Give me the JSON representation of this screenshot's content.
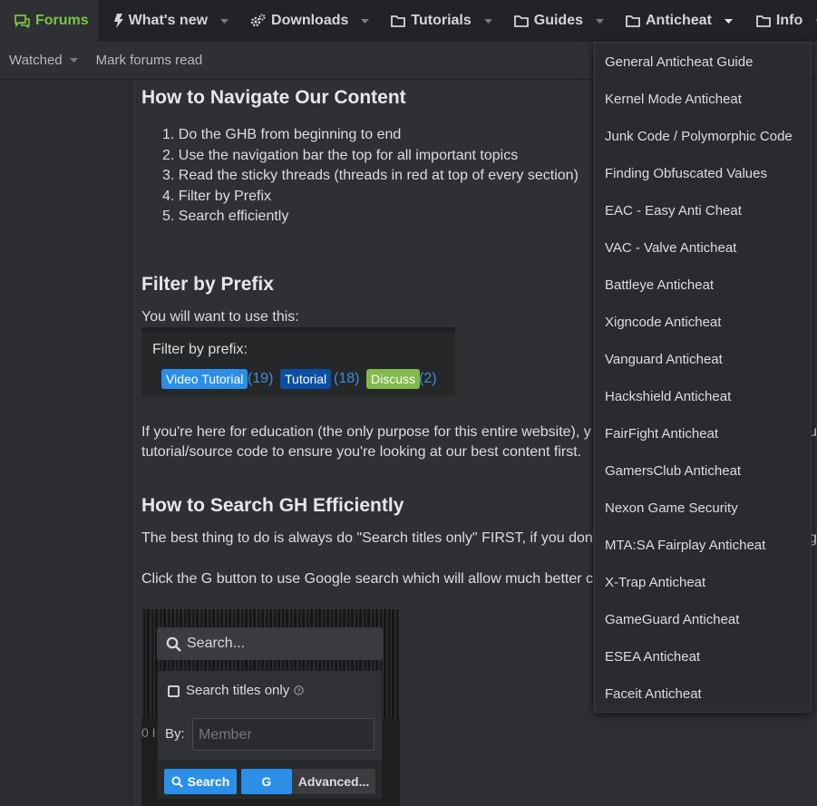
{
  "nav": {
    "tabs": [
      {
        "label": "Forums",
        "icon": "chat-bubbles-icon",
        "active": true
      },
      {
        "label": "What's new",
        "icon": "lightning-icon"
      },
      {
        "label": "Downloads",
        "icon": "gears-icon"
      },
      {
        "label": "Tutorials",
        "icon": "folder-icon"
      },
      {
        "label": "Guides",
        "icon": "folder-icon"
      },
      {
        "label": "Anticheat",
        "icon": "folder-icon"
      },
      {
        "label": "Info",
        "icon": "folder-icon"
      }
    ]
  },
  "subnav": {
    "watched": "Watched",
    "mark_read": "Mark forums read"
  },
  "content": {
    "h_navigate": "How to Navigate Our Content",
    "steps": [
      "1. Do the GHB from beginning to end",
      "2. Use the navigation bar the top for all important topics",
      "3. Read the sticky threads (threads in red at top of every section)",
      "4. Filter by Prefix",
      "5. Search efficiently"
    ],
    "h_filter": "Filter by Prefix",
    "use_this": "You will want to use this:",
    "prefix_box": {
      "label": "Filter by prefix:",
      "chips": [
        {
          "label": "Video Tutorial",
          "count": "(19)",
          "color": "#2b8fe8"
        },
        {
          "label": "Tutorial",
          "count": "(18)",
          "color": "#0c4ea2"
        },
        {
          "label": "Discuss",
          "count": "(2)",
          "color": "#82b94a"
        }
      ]
    },
    "education_line1": "If you're here for education (the only purpose for this entire website), y",
    "education_line1_tail": "u",
    "education_line2": "tutorial/source code to ensure you're looking at our best content first.",
    "h_search": "How to Search GH Efficiently",
    "search_line": "The best thing to do is always do \"Search titles only\" FIRST, if you don't",
    "search_line_tail": "g",
    "google_line": "Click the G button to use Google search which will allow much better c",
    "search_widget": {
      "placeholder": "Search...",
      "titles_only": "Search titles only",
      "by_label": "By:",
      "member_placeholder": "Member",
      "search_btn": "Search",
      "g_btn": "G",
      "advanced_btn": "Advanced...",
      "stub": "0 I"
    }
  },
  "dropdown": {
    "items": [
      "General Anticheat Guide",
      "Kernel Mode Anticheat",
      "Junk Code / Polymorphic Code",
      "Finding Obfuscated Values",
      "EAC - Easy Anti Cheat",
      "VAC - Valve Anticheat",
      "Battleye Anticheat",
      "Xigncode Anticheat",
      "Vanguard Anticheat",
      "Hackshield Anticheat",
      "FairFight Anticheat",
      "GamersClub Anticheat",
      "Nexon Game Security",
      "MTA:SA Fairplay Anticheat",
      "X-Trap Anticheat",
      "GameGuard Anticheat",
      "ESEA Anticheat",
      "Faceit Anticheat"
    ]
  },
  "colors": {
    "accent_green": "#7cc446",
    "link_blue": "#3d8fd9",
    "button_blue": "#2b8fe8"
  }
}
